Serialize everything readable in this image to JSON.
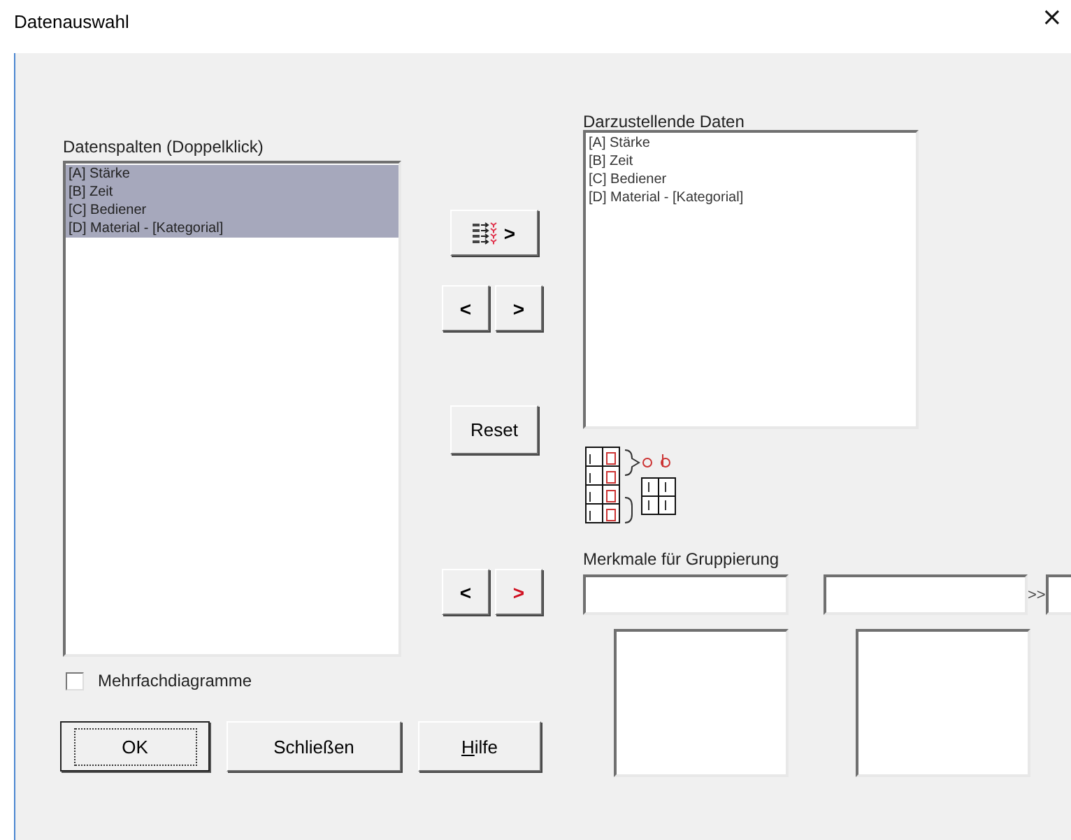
{
  "window": {
    "title": "Datenauswahl",
    "close": "×"
  },
  "source_list": {
    "label": "Datenspalten (Doppelklick)",
    "items": [
      {
        "text": "[A]  Stärke",
        "selected": true
      },
      {
        "text": "[B]  Zeit",
        "selected": true
      },
      {
        "text": "[C]  Bediener",
        "selected": true
      },
      {
        "text": "[D]  Material - [Kategorial]",
        "selected": true
      }
    ]
  },
  "move_buttons": [
    {
      "kind": "all",
      "label": ">"
    },
    {
      "kind": "arrow",
      "label": "<"
    },
    {
      "kind": "arrow",
      "label": ">"
    }
  ],
  "reset_button": "Reset",
  "target_list": {
    "label": "Darzustellende Daten",
    "items": [
      {
        "text": "[A]  Stärke",
        "selected": false
      },
      {
        "text": "[B]  Zeit",
        "selected": false
      },
      {
        "text": "[C]  Bediener",
        "selected": false
      },
      {
        "text": "[D]  Material - [Kategorial]",
        "selected": false
      }
    ]
  },
  "group_buttons": [
    {
      "label": "<",
      "active": false
    },
    {
      "label": ">",
      "active": true
    }
  ],
  "grouping": {
    "label": "Merkmale für Gruppierung",
    "more": ">>"
  },
  "multiple_charts": {
    "label": "Mehrfachdiagramme",
    "checked": false
  },
  "buttons": [
    {
      "label": "OK",
      "default": true,
      "underline_first": false
    },
    {
      "label": "Schließen",
      "default": false,
      "underline_first": false
    },
    {
      "label": "Hilfe",
      "default": false,
      "underline_first": true
    }
  ]
}
